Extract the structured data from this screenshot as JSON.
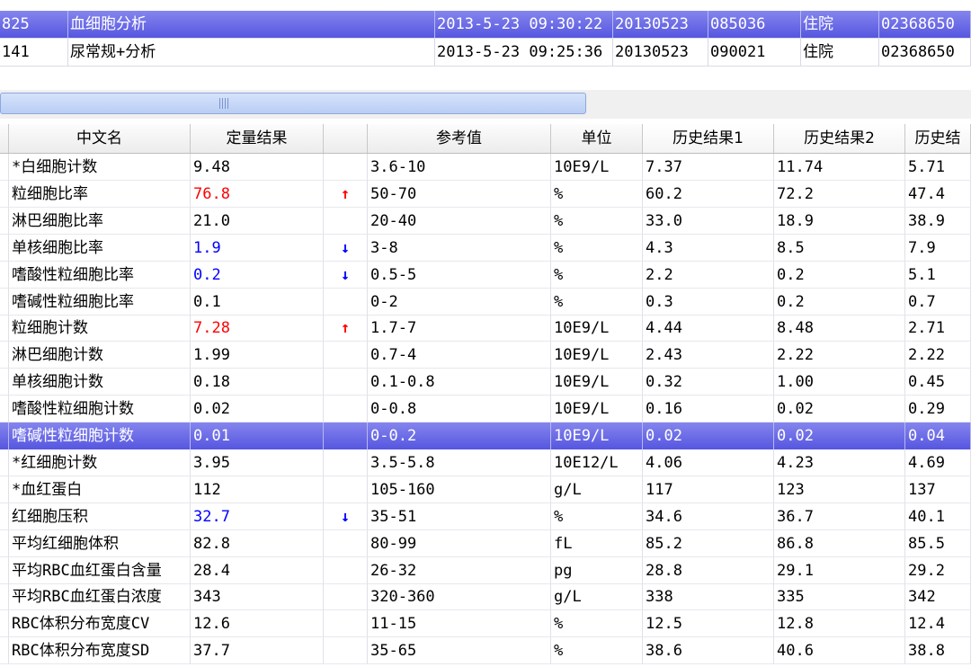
{
  "orders": [
    {
      "id": "825",
      "name": "血细胞分析",
      "time": "2013-5-23 09:30:22",
      "date": "20130523",
      "sample": "085036",
      "type": "住院",
      "patient": "02368650",
      "selected": true
    },
    {
      "id": "141",
      "name": "尿常规+分析",
      "time": "2013-5-23 09:25:36",
      "date": "20130523",
      "sample": "090021",
      "type": "住院",
      "patient": "02368650",
      "selected": false
    }
  ],
  "columns": {
    "name": "中文名",
    "result": "定量结果",
    "flag": "",
    "ref": "参考值",
    "unit": "单位",
    "hist1": "历史结果1",
    "hist2": "历史结果2",
    "hist3": "历史结"
  },
  "colors": {
    "high": "#ff0000",
    "low": "#0000ff",
    "selection": "#5656e0"
  },
  "results": [
    {
      "name": "*白细胞计数",
      "result": "9.48",
      "flag": "",
      "ref": "3.6-10",
      "unit": "10E9/L",
      "h1": "7.37",
      "h2": "11.74",
      "h3": "5.71"
    },
    {
      "name": "粒细胞比率",
      "result": "76.8",
      "flag": "high",
      "ref": "50-70",
      "unit": "%",
      "h1": "60.2",
      "h2": "72.2",
      "h3": "47.4"
    },
    {
      "name": "淋巴细胞比率",
      "result": "21.0",
      "flag": "",
      "ref": "20-40",
      "unit": "%",
      "h1": "33.0",
      "h2": "18.9",
      "h3": "38.9"
    },
    {
      "name": "单核细胞比率",
      "result": "1.9",
      "flag": "low",
      "ref": "3-8",
      "unit": "%",
      "h1": "4.3",
      "h2": "8.5",
      "h3": "7.9"
    },
    {
      "name": "嗜酸性粒细胞比率",
      "result": "0.2",
      "flag": "low",
      "ref": "0.5-5",
      "unit": "%",
      "h1": "2.2",
      "h2": "0.2",
      "h3": "5.1"
    },
    {
      "name": "嗜碱性粒细胞比率",
      "result": "0.1",
      "flag": "",
      "ref": "0-2",
      "unit": "%",
      "h1": "0.3",
      "h2": "0.2",
      "h3": "0.7"
    },
    {
      "name": "粒细胞计数",
      "result": "7.28",
      "flag": "high",
      "ref": "1.7-7",
      "unit": "10E9/L",
      "h1": "4.44",
      "h2": "8.48",
      "h3": "2.71"
    },
    {
      "name": "淋巴细胞计数",
      "result": "1.99",
      "flag": "",
      "ref": "0.7-4",
      "unit": "10E9/L",
      "h1": "2.43",
      "h2": "2.22",
      "h3": "2.22"
    },
    {
      "name": "单核细胞计数",
      "result": "0.18",
      "flag": "",
      "ref": "0.1-0.8",
      "unit": "10E9/L",
      "h1": "0.32",
      "h2": "1.00",
      "h3": "0.45"
    },
    {
      "name": "嗜酸性粒细胞计数",
      "result": "0.02",
      "flag": "",
      "ref": "0-0.8",
      "unit": "10E9/L",
      "h1": "0.16",
      "h2": "0.02",
      "h3": "0.29"
    },
    {
      "name": "嗜碱性粒细胞计数",
      "result": "0.01",
      "flag": "",
      "ref": "0-0.2",
      "unit": "10E9/L",
      "h1": "0.02",
      "h2": "0.02",
      "h3": "0.04",
      "selected": true
    },
    {
      "name": "*红细胞计数",
      "result": "3.95",
      "flag": "",
      "ref": "3.5-5.8",
      "unit": "10E12/L",
      "h1": "4.06",
      "h2": "4.23",
      "h3": "4.69"
    },
    {
      "name": "*血红蛋白",
      "result": "112",
      "flag": "",
      "ref": "105-160",
      "unit": "g/L",
      "h1": "117",
      "h2": "123",
      "h3": "137"
    },
    {
      "name": "红细胞压积",
      "result": "32.7",
      "flag": "low",
      "ref": "35-51",
      "unit": "%",
      "h1": "34.6",
      "h2": "36.7",
      "h3": "40.1"
    },
    {
      "name": "平均红细胞体积",
      "result": "82.8",
      "flag": "",
      "ref": "80-99",
      "unit": "fL",
      "h1": "85.2",
      "h2": "86.8",
      "h3": "85.5"
    },
    {
      "name": "平均RBC血红蛋白含量",
      "result": "28.4",
      "flag": "",
      "ref": "26-32",
      "unit": "pg",
      "h1": "28.8",
      "h2": "29.1",
      "h3": "29.2"
    },
    {
      "name": "平均RBC血红蛋白浓度",
      "result": "343",
      "flag": "",
      "ref": "320-360",
      "unit": "g/L",
      "h1": "338",
      "h2": "335",
      "h3": "342"
    },
    {
      "name": "RBC体积分布宽度CV",
      "result": "12.6",
      "flag": "",
      "ref": "11-15",
      "unit": "%",
      "h1": "12.5",
      "h2": "12.8",
      "h3": "12.4"
    },
    {
      "name": "RBC体积分布宽度SD",
      "result": "37.7",
      "flag": "",
      "ref": "35-65",
      "unit": "%",
      "h1": "38.6",
      "h2": "40.6",
      "h3": "38.8"
    }
  ]
}
